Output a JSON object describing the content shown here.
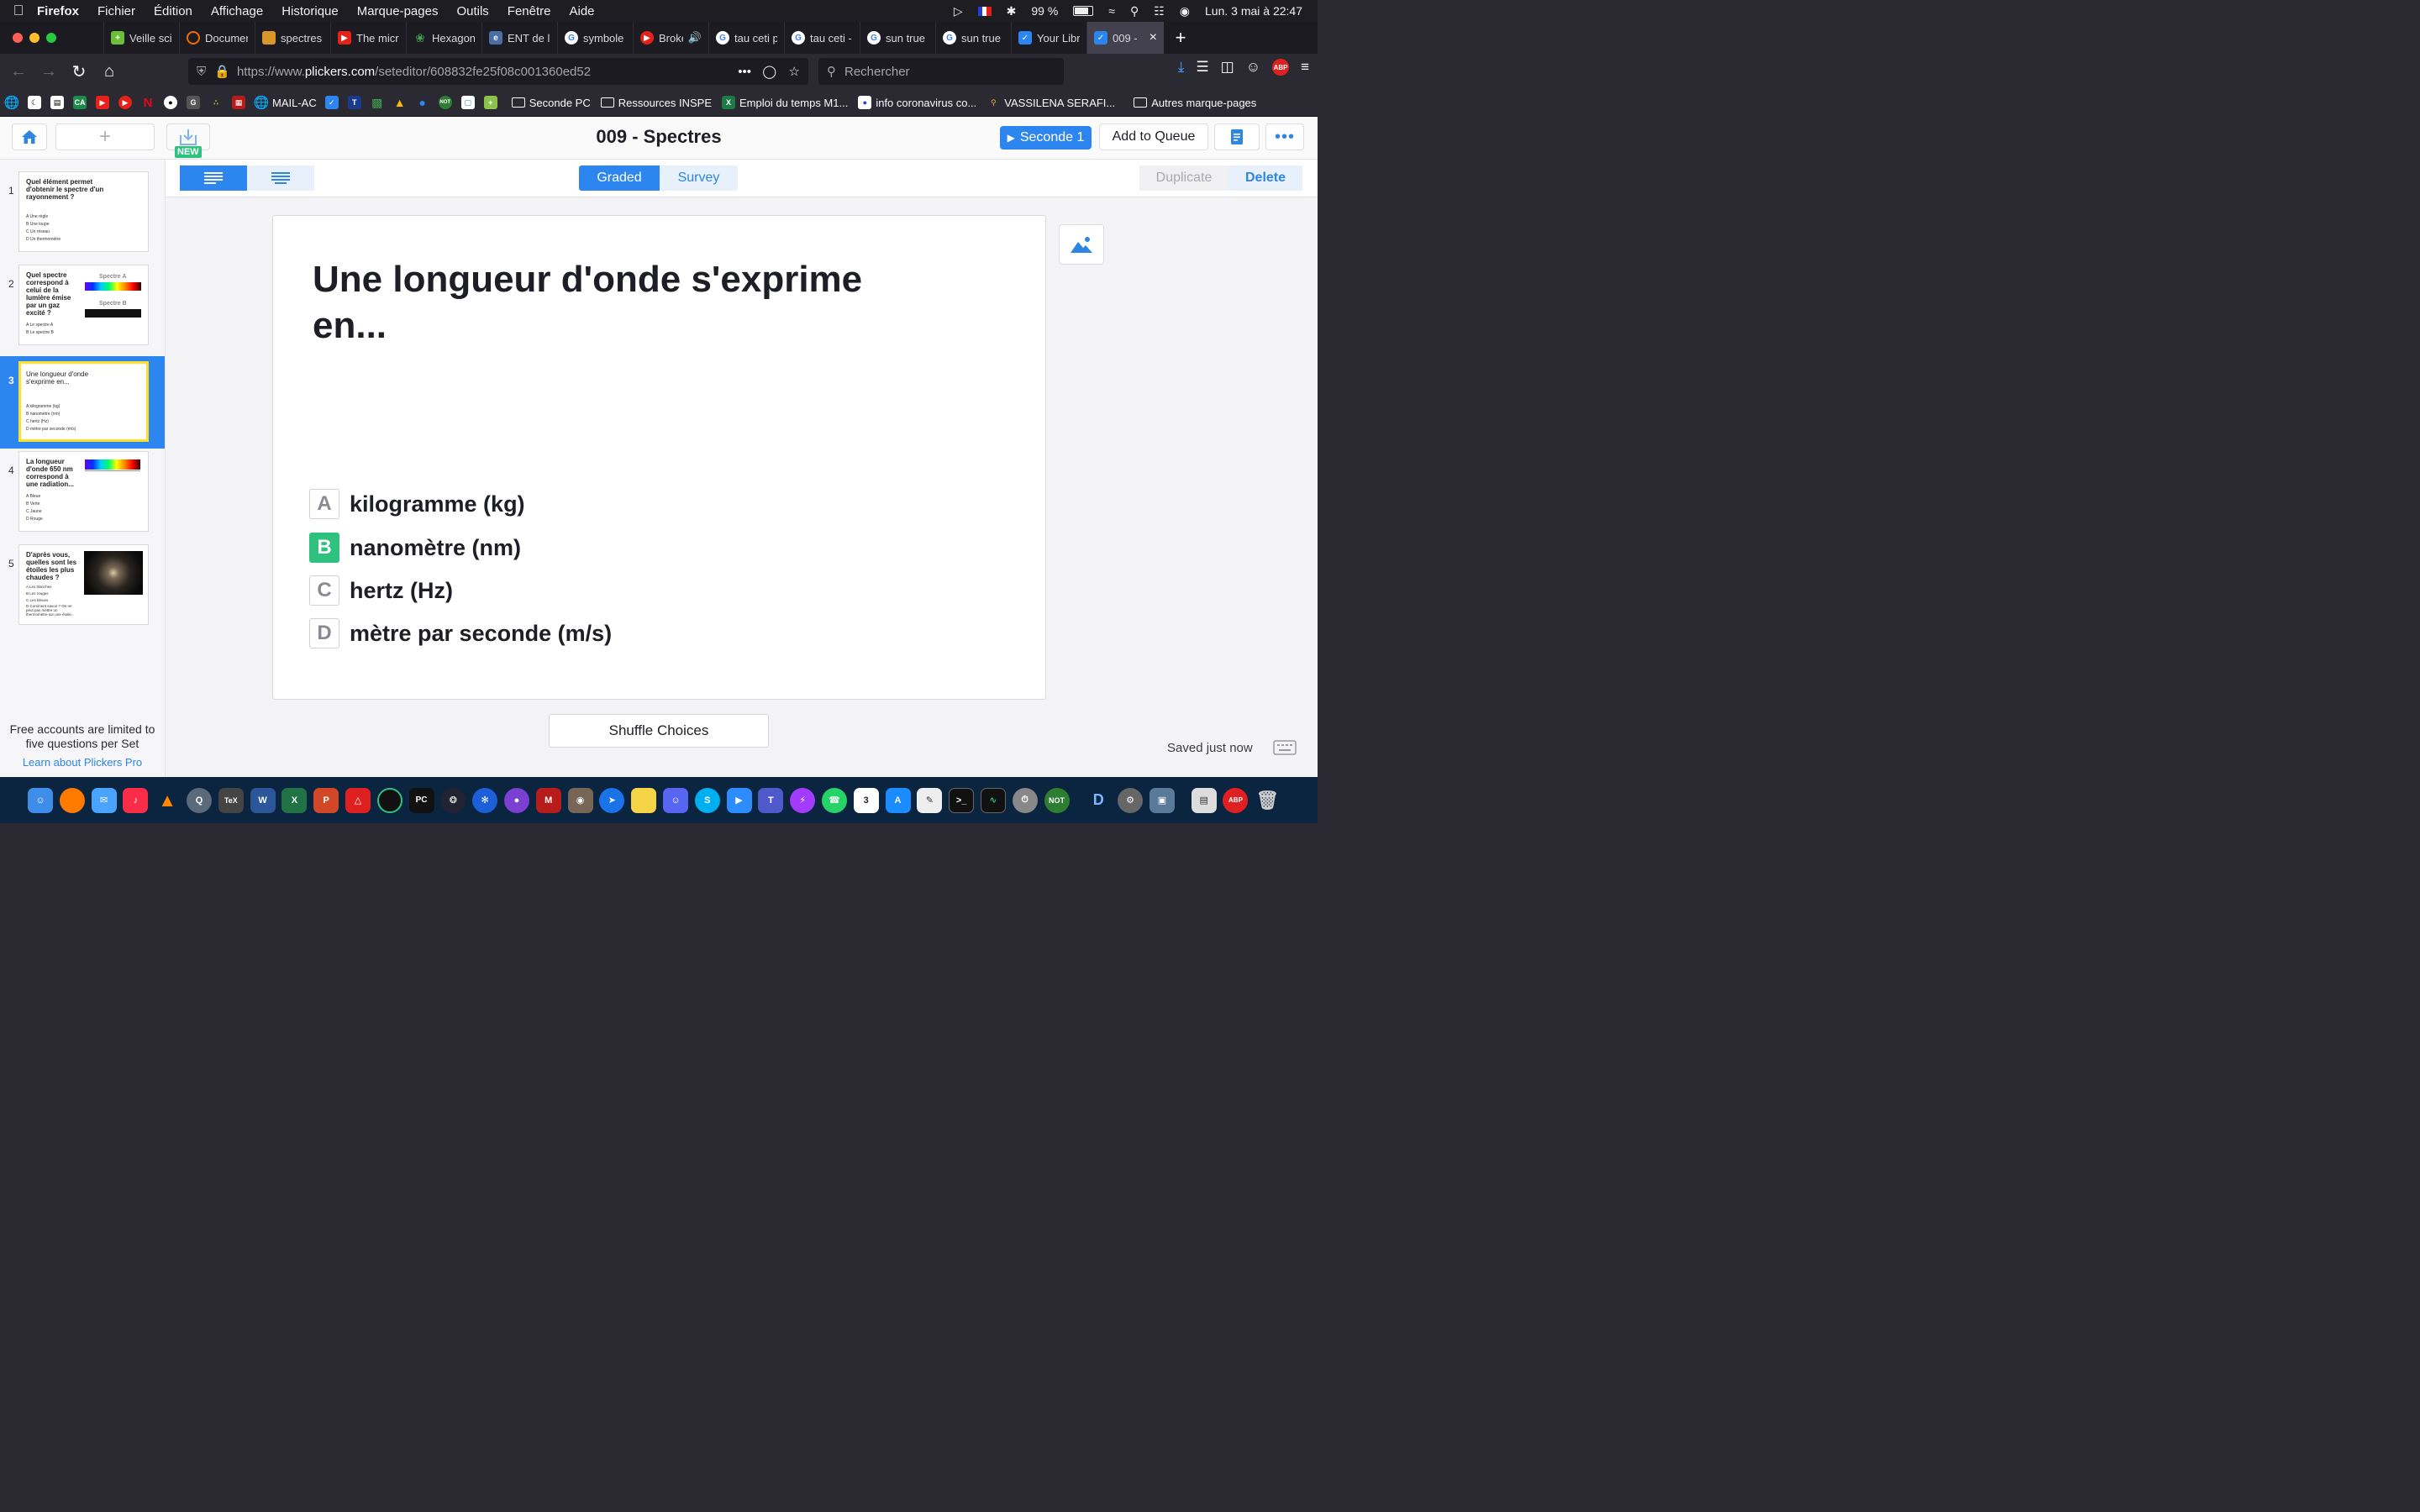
{
  "menubar": {
    "app_name": "Firefox",
    "items": [
      "Fichier",
      "Édition",
      "Affichage",
      "Historique",
      "Marque-pages",
      "Outils",
      "Fenêtre",
      "Aide"
    ],
    "battery_percent": "99 %",
    "datetime": "Lun. 3 mai à  22:47"
  },
  "tabs": [
    {
      "label": "Veille sci",
      "icon_color": "#6cbf3a"
    },
    {
      "label": "Documen",
      "icon_color": "#ef6c00"
    },
    {
      "label": "spectres",
      "icon_color": "#d9972b"
    },
    {
      "label": "The micr",
      "icon_color": "#e62117"
    },
    {
      "label": "Hexagon",
      "icon_color": "#3fa34d"
    },
    {
      "label": "ENT de l'",
      "icon_color": "#4a6fa5"
    },
    {
      "label": "symbole",
      "icon_color": "#4285f4"
    },
    {
      "label": "Broke",
      "icon_color": "#e62117"
    },
    {
      "label": "tau ceti p",
      "icon_color": "#4285f4"
    },
    {
      "label": "tau ceti -",
      "icon_color": "#4285f4"
    },
    {
      "label": "sun true",
      "icon_color": "#4285f4"
    },
    {
      "label": "sun true",
      "icon_color": "#4285f4"
    },
    {
      "label": "Your Libr",
      "icon_color": "#2d86f0"
    },
    {
      "label": "009 -",
      "icon_color": "#2d86f0",
      "active": true
    }
  ],
  "navbar": {
    "url_prefix": "https://www.",
    "url_host": "plickers.com",
    "url_path": "/seteditor/608832fe25f08c001360ed52",
    "search_placeholder": "Rechercher"
  },
  "bookmarks": {
    "items": [
      "MAIL-AC",
      "Seconde PC",
      "Ressources INSPE",
      "Emploi du temps M1...",
      "info coronavirus co...",
      "VASSILENA SERAFI...",
      "Autres marque-pages"
    ]
  },
  "app": {
    "set_title": "009 - Spectres",
    "new_badge": "NEW",
    "class_button": "Seconde 1",
    "queue_button": "Add to Queue",
    "mode_graded": "Graded",
    "mode_survey": "Survey",
    "duplicate": "Duplicate",
    "delete": "Delete",
    "shuffle": "Shuffle Choices",
    "saved": "Saved just now",
    "limit_text": "Free accounts are limited to five questions per Set",
    "pro_link": "Learn about Plickers Pro"
  },
  "question": {
    "text": "Une longueur d'onde s'exprime en...",
    "choices": [
      {
        "letter": "A",
        "text": "kilogramme (kg)",
        "correct": false
      },
      {
        "letter": "B",
        "text": "nanomètre (nm)",
        "correct": true
      },
      {
        "letter": "C",
        "text": "hertz (Hz)",
        "correct": false
      },
      {
        "letter": "D",
        "text": "mètre par seconde (m/s)",
        "correct": false
      }
    ]
  },
  "slides": [
    {
      "num": "1",
      "question": "Quel élément permet d'obtenir le spectre d'un rayonnement ?",
      "choices": [
        "A  Une règle",
        "B  Une loupe",
        "C  Un réseau",
        "D  Un thermomètre"
      ]
    },
    {
      "num": "2",
      "question": "Quel spectre correspond à celui de la lumière émise par un gaz excité ?",
      "choices": [
        "A  Le spectre A",
        "B  Le spectre B"
      ],
      "labels": [
        "Spectre A",
        "Spectre B"
      ]
    },
    {
      "num": "3",
      "question": "Une longueur d'onde s'exprime en...",
      "choices": [
        "A  kilogramme (kg)",
        "B  nanomètre (nm)",
        "C  hertz (Hz)",
        "D  mètre par seconde (m/s)"
      ]
    },
    {
      "num": "4",
      "question": "La longueur d'onde 650 nm correspond à une radiation...",
      "choices": [
        "A  Bleue",
        "B  Verte",
        "C  Jaune",
        "D  Rouge"
      ]
    },
    {
      "num": "5",
      "question": "D'après vous, quelles sont les étoiles les plus chaudes ?",
      "choices": [
        "A  Les blanches",
        "B  Les rouges",
        "C  Les bleues",
        "D  Comment savoir ? On ne peut pas mettre un thermomètre sur une étoile..."
      ]
    }
  ],
  "dock": [
    "finder",
    "firefox",
    "mail",
    "music",
    "vlc",
    "quicktime",
    "texmaker",
    "word",
    "excel",
    "powerpoint",
    "acrobat",
    "gitkraken",
    "pycharm",
    "davinci",
    "xcode-instruments",
    "github",
    "mendeley",
    "gimp",
    "safari",
    "notes",
    "discord",
    "skype",
    "zoom",
    "teams",
    "messenger",
    "whatsapp",
    "calendar",
    "appstore",
    "textedit",
    "terminal",
    "activity",
    "timer",
    "notability",
    "diablo",
    "preferences",
    "screenshot",
    "preview",
    "adblock",
    "trash"
  ],
  "colors": {
    "accent": "#2d86f0",
    "correct": "#2ec27e",
    "selected_border": "#ffdf2a"
  }
}
